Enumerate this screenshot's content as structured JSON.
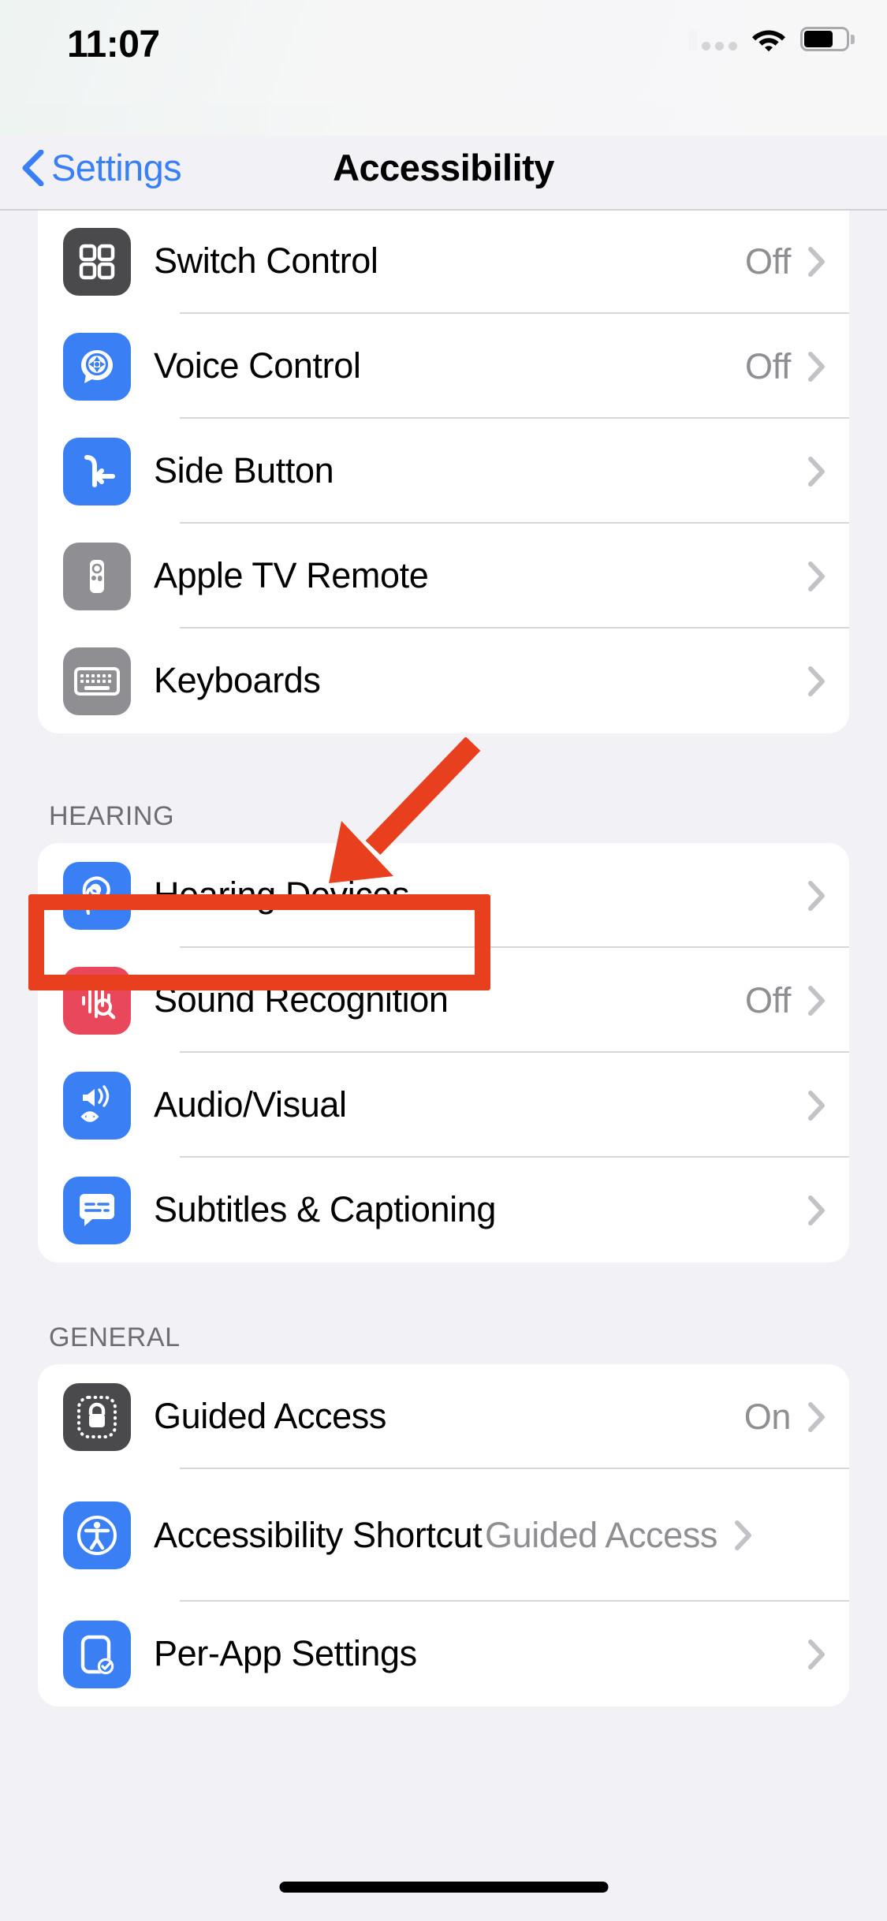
{
  "status_bar": {
    "time": "11:07",
    "cellular_icon": "cellular-dots-icon",
    "wifi_icon": "wifi-icon",
    "battery_icon": "battery-icon",
    "battery_level_percent": 70
  },
  "nav": {
    "back_label": "Settings",
    "back_icon": "chevron-left-icon",
    "title": "Accessibility"
  },
  "colors": {
    "accent_blue": "#3b7ff5",
    "icon_blue": "#3b7ff5",
    "icon_gray_dark": "#4a4a4d",
    "icon_gray": "#8e8e93",
    "icon_red": "#e9485c",
    "annotation_red": "#e8401f",
    "value_gray": "#8e8e93",
    "separator": "#d7d7db"
  },
  "sections": [
    {
      "header": "",
      "rows": [
        {
          "label": "Switch Control",
          "value": "Off",
          "icon": "switch-control-icon",
          "icon_style": "gray-dark"
        },
        {
          "label": "Voice Control",
          "value": "Off",
          "icon": "voice-control-icon",
          "icon_style": "blue"
        },
        {
          "label": "Side Button",
          "value": "",
          "icon": "side-button-icon",
          "icon_style": "blue"
        },
        {
          "label": "Apple TV Remote",
          "value": "",
          "icon": "apple-tv-remote-icon",
          "icon_style": "gray"
        },
        {
          "label": "Keyboards",
          "value": "",
          "icon": "keyboard-icon",
          "icon_style": "gray"
        }
      ]
    },
    {
      "header": "Hearing",
      "rows": [
        {
          "label": "Hearing Devices",
          "value": "",
          "icon": "ear-icon",
          "icon_style": "blue"
        },
        {
          "label": "Sound Recognition",
          "value": "Off",
          "icon": "sound-recognition-icon",
          "icon_style": "red"
        },
        {
          "label": "Audio/Visual",
          "value": "",
          "icon": "audio-visual-icon",
          "icon_style": "blue"
        },
        {
          "label": "Subtitles & Captioning",
          "value": "",
          "icon": "subtitles-icon",
          "icon_style": "blue"
        }
      ]
    },
    {
      "header": "General",
      "rows": [
        {
          "label": "Guided Access",
          "value": "On",
          "icon": "guided-access-icon",
          "icon_style": "gray-dark"
        },
        {
          "label": "Accessibility Shortcut",
          "value": "Guided Access",
          "icon": "accessibility-shortcut-icon",
          "icon_style": "blue"
        },
        {
          "label": "Per-App Settings",
          "value": "",
          "icon": "per-app-settings-icon",
          "icon_style": "blue"
        }
      ]
    }
  ],
  "annotation": {
    "highlight_target": "Guided Access",
    "box_color": "#e8401f",
    "arrow_color": "#e8401f",
    "arrow_points_to": "Guided Access"
  },
  "chevron_icon": "chevron-right-icon",
  "home_indicator": "home-indicator"
}
